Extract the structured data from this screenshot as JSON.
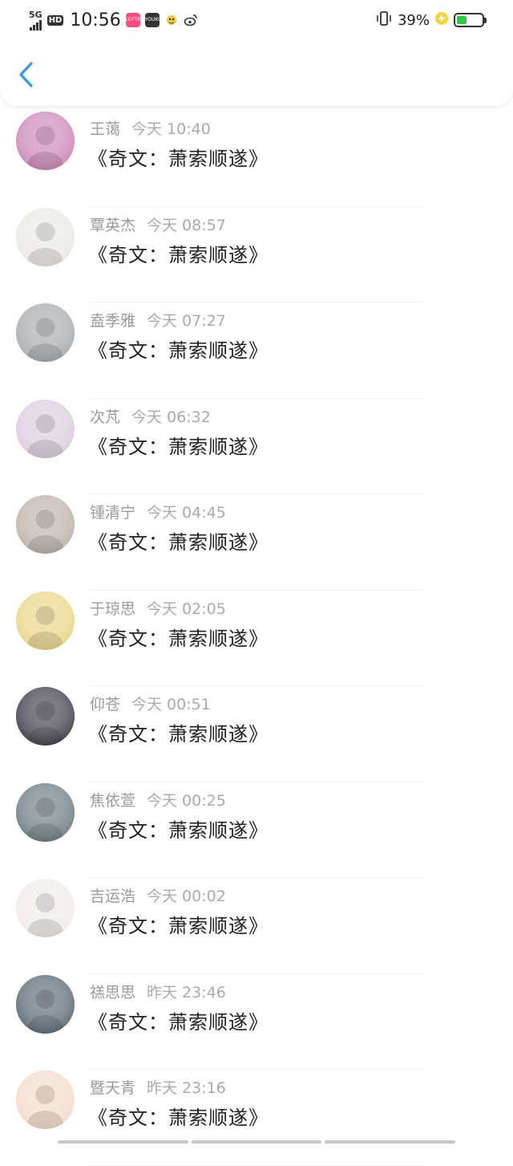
{
  "status_bar": {
    "network": "5G",
    "hd": "HD",
    "time": "10:56",
    "battery_percent": "39%",
    "battery_level": 0.39,
    "app_icons": [
      "lofter-icon",
      "youku-icon",
      "chat-app-icon",
      "weibo-icon"
    ],
    "app_icon_labels": {
      "lofter": "LOFTER",
      "youku": "YOUKU"
    }
  },
  "header": {
    "back_icon": "chevron-left-icon",
    "accent_color": "#2e9df0"
  },
  "list": [
    {
      "name": "王蔼",
      "time": "今天 10:40",
      "title": "《奇文：萧索顺遂》",
      "avatar_color": "#c77ab0"
    },
    {
      "name": "覃英杰",
      "time": "今天 08:57",
      "title": "《奇文：萧索顺遂》",
      "avatar_color": "#e9e6e0"
    },
    {
      "name": "盍季雅",
      "time": "今天 07:27",
      "title": "《奇文：萧索顺遂》",
      "avatar_color": "#9ea3a6"
    },
    {
      "name": "次芃",
      "time": "今天 06:32",
      "title": "《奇文：萧索顺遂》",
      "avatar_color": "#d9c6dc"
    },
    {
      "name": "锺清宁",
      "time": "今天 04:45",
      "title": "《奇文：萧索顺遂》",
      "avatar_color": "#b7aaa0"
    },
    {
      "name": "于琼思",
      "time": "今天 02:05",
      "title": "《奇文：萧索顺遂》",
      "avatar_color": "#e8d27a"
    },
    {
      "name": "仰苍",
      "time": "今天 00:51",
      "title": "《奇文：萧索顺遂》",
      "avatar_color": "#2a2a38"
    },
    {
      "name": "焦依萱",
      "time": "今天 00:25",
      "title": "《奇文：萧索顺遂》",
      "avatar_color": "#5d6e76"
    },
    {
      "name": "吉运浩",
      "time": "今天 00:02",
      "title": "《奇文：萧索顺遂》",
      "avatar_color": "#f0e8e6"
    },
    {
      "name": "禚思思",
      "time": "昨天 23:46",
      "title": "《奇文：萧索顺遂》",
      "avatar_color": "#4a5a66"
    },
    {
      "name": "暨天青",
      "time": "昨天 23:16",
      "title": "《奇文：萧索顺遂》",
      "avatar_color": "#f2d8c4"
    }
  ]
}
